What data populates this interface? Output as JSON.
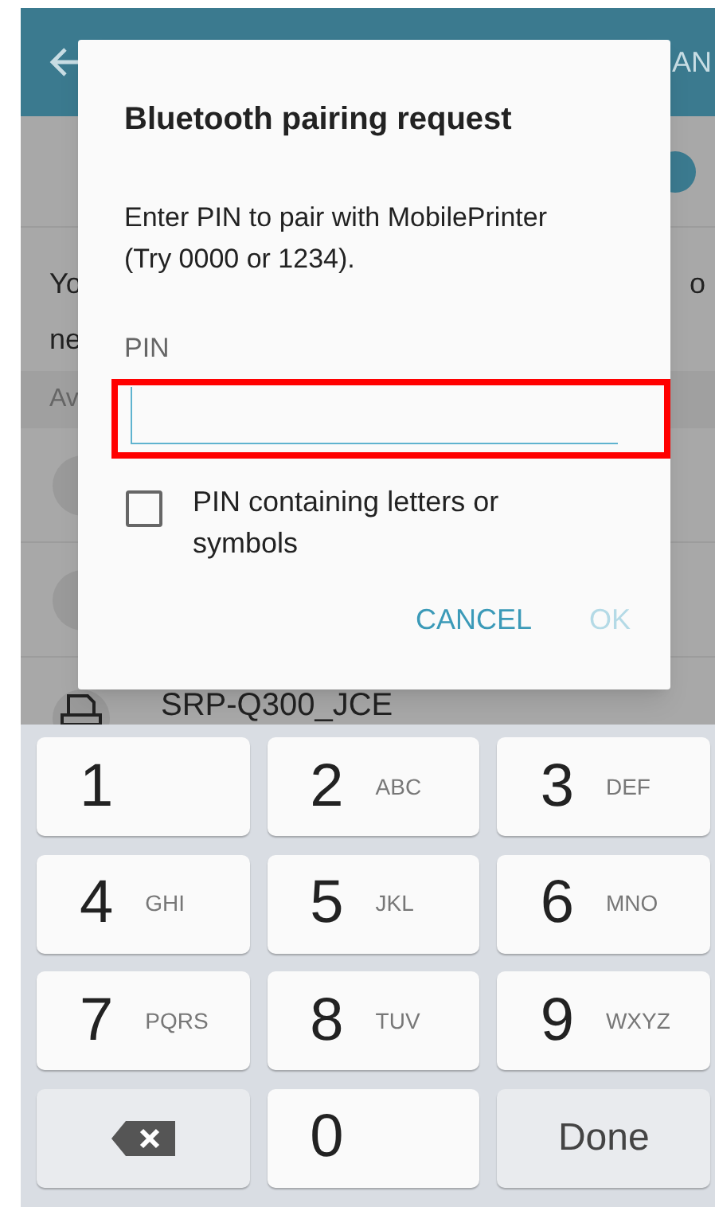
{
  "app_bar": {
    "action": "AN"
  },
  "background": {
    "texts": [
      "Yo",
      "ne"
    ],
    "right_text": "o",
    "section_header": "Av",
    "device": "SRP-Q300_JCE"
  },
  "dialog": {
    "title": "Bluetooth pairing request",
    "message": "Enter PIN to pair with MobilePrinter (Try 0000 or 1234).",
    "field_label": "PIN",
    "field": {
      "highlighted": true
    },
    "checkbox": {
      "label": "PIN containing letters or symbols",
      "checked": false
    },
    "buttons": [
      {
        "label": "CANCEL",
        "disabled": false
      },
      {
        "label": "OK",
        "disabled": true
      }
    ]
  },
  "keyboard": {
    "keys": [
      {
        "kind": "digit",
        "digit": "1"
      },
      {
        "kind": "digit",
        "digit": "2",
        "letters": "ABC"
      },
      {
        "kind": "digit",
        "digit": "3",
        "letters": "DEF"
      },
      {
        "kind": "digit",
        "digit": "4",
        "letters": "GHI"
      },
      {
        "kind": "digit",
        "digit": "5",
        "letters": "JKL"
      },
      {
        "kind": "digit",
        "digit": "6",
        "letters": "MNO"
      },
      {
        "kind": "digit",
        "digit": "7",
        "letters": "PQRS"
      },
      {
        "kind": "digit",
        "digit": "8",
        "letters": "TUV"
      },
      {
        "kind": "digit",
        "digit": "9",
        "letters": "WXYZ"
      },
      {
        "kind": "backspace"
      },
      {
        "kind": "digit",
        "digit": "0"
      },
      {
        "kind": "done",
        "label": "Done"
      }
    ]
  }
}
